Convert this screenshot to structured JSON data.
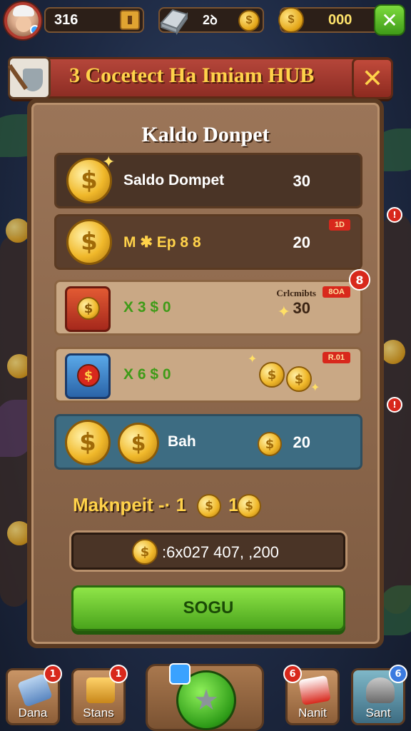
{
  "topbar": {
    "xp_value": "316",
    "gem_value": "2ꝺ",
    "coin_value": "000",
    "close_symbol": "✕"
  },
  "header": {
    "title": "3 Cocetect Ha Imiam HUB",
    "close_symbol": "✕"
  },
  "panel": {
    "title": "Kaldo Donpet",
    "rows": [
      {
        "label": "Saldo Dompet",
        "value": "30"
      },
      {
        "label": "M ✱ Ep 8 8",
        "value": "20",
        "badge": "1D"
      },
      {
        "label": "X 3 $ 0",
        "value": "30",
        "note": "Crlcmibts",
        "badge": "8OA",
        "circle_badge": "8"
      },
      {
        "label": "X 6 $ 0",
        "value": "",
        "badge": "R.01"
      },
      {
        "label": "Bah",
        "value": "20"
      }
    ],
    "coin_symbol": "$",
    "makpeit": {
      "label": "Maknpeit -· 1",
      "mid": "1"
    },
    "code_text": ":6x027 407, ,200",
    "action_button": "SOGU"
  },
  "nav": {
    "items": [
      {
        "label": "Dana",
        "badge": "1"
      },
      {
        "label": "Stans",
        "badge": "1"
      },
      {
        "label": "Nanit",
        "badge": "6"
      },
      {
        "label": "Sant",
        "badge": "6"
      }
    ]
  },
  "colors": {
    "accent_gold": "#ffd24a",
    "banner_red": "#b5463a",
    "button_green": "#6bdc2a",
    "panel_brown": "#8d6a4f"
  }
}
